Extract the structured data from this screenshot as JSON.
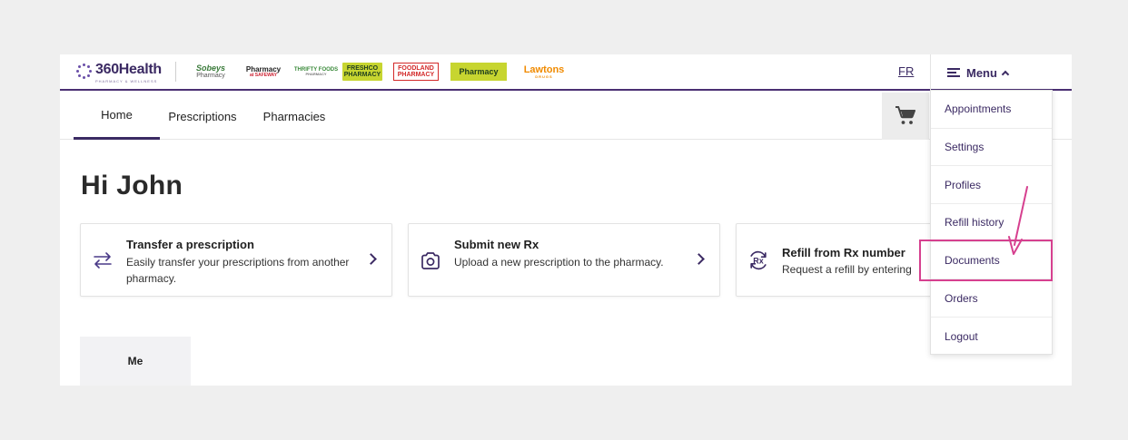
{
  "header": {
    "logo_text": "360Health",
    "logo_subtext": "PHARMACY & WELLNESS",
    "banners": {
      "sobeys": "Sobeys",
      "sobeys_sub": "Pharmacy",
      "safeway": "Pharmacy",
      "safeway_sub": "at SAFEWAY",
      "thrifty": "THRIFTY FOODS",
      "thrifty_sub": "PHARMACY",
      "freshco": "FRESHCO",
      "freshco_sub": "PHARMACY",
      "foodland": "FOODLAND",
      "foodland_sub": "PHARMACY",
      "chalo": "Pharmacy",
      "lawtons": "Lawtons",
      "lawtons_sub": "DRUGS"
    },
    "language_toggle": "FR",
    "menu_label": "Menu"
  },
  "nav": {
    "tabs": [
      {
        "label": "Home",
        "active": true
      },
      {
        "label": "Prescriptions",
        "active": false
      },
      {
        "label": "Pharmacies",
        "active": false
      }
    ]
  },
  "main": {
    "greeting": "Hi John",
    "cards": [
      {
        "title": "Transfer a prescription",
        "description": "Easily transfer your prescriptions from another pharmacy.",
        "icon": "transfer-arrows-icon"
      },
      {
        "title": "Submit new Rx",
        "description": "Upload a new prescription to the pharmacy.",
        "icon": "camera-icon"
      },
      {
        "title": "Refill from Rx number",
        "description": "Request a refill by entering",
        "icon": "rx-refill-icon"
      }
    ],
    "profile_tab": "Me"
  },
  "menu": {
    "items": [
      {
        "label": "Appointments"
      },
      {
        "label": "Settings"
      },
      {
        "label": "Profiles"
      },
      {
        "label": "Refill history"
      },
      {
        "label": "Documents",
        "highlighted": true
      },
      {
        "label": "Orders"
      },
      {
        "label": "Logout"
      }
    ]
  },
  "colors": {
    "brand_purple": "#3b2a63",
    "annotation_pink": "#d6408f",
    "background": "#efefef"
  }
}
